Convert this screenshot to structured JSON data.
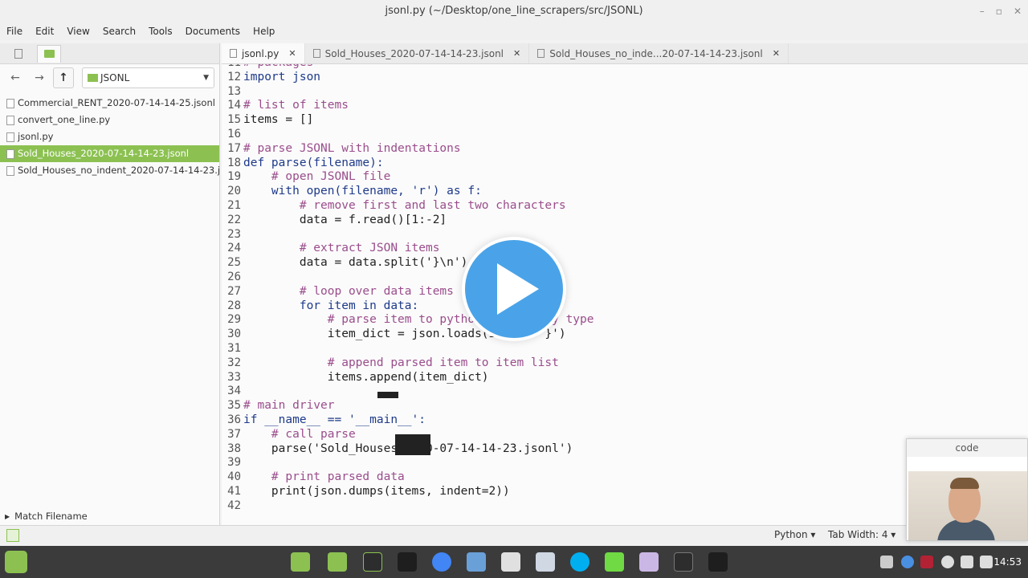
{
  "window": {
    "title": "jsonl.py (~/Desktop/one_line_scrapers/src/JSONL)"
  },
  "menu": [
    "File",
    "Edit",
    "View",
    "Search",
    "Tools",
    "Documents",
    "Help"
  ],
  "sidebar": {
    "path": "JSONL",
    "files": [
      "Commercial_RENT_2020-07-14-14-25.jsonl",
      "convert_one_line.py",
      "jsonl.py",
      "Sold_Houses_2020-07-14-14-23.jsonl",
      "Sold_Houses_no_indent_2020-07-14-14-23.jsonl"
    ],
    "selected_index": 3,
    "footer": "Match Filename"
  },
  "tabs": [
    "jsonl.py",
    "Sold_Houses_2020-07-14-14-23.jsonl",
    "Sold_Houses_no_inde...20-07-14-14-23.jsonl"
  ],
  "code": [
    {
      "n": "11",
      "text": "# packages",
      "cls": "c"
    },
    {
      "n": "12",
      "text": "import json",
      "cls": "k"
    },
    {
      "n": "13",
      "text": "",
      "cls": "t"
    },
    {
      "n": "14",
      "text": "# list of items",
      "cls": "c"
    },
    {
      "n": "15",
      "text": "items = []",
      "cls": "t"
    },
    {
      "n": "16",
      "text": "",
      "cls": "t"
    },
    {
      "n": "17",
      "text": "# parse JSONL with indentations",
      "cls": "c"
    },
    {
      "n": "18",
      "text": "def parse(filename):",
      "cls": "k"
    },
    {
      "n": "19",
      "text": "    # open JSONL file",
      "cls": "c"
    },
    {
      "n": "20",
      "text": "    with open(filename, 'r') as f:",
      "cls": "k"
    },
    {
      "n": "21",
      "text": "        # remove first and last two characters",
      "cls": "c"
    },
    {
      "n": "22",
      "text": "        data = f.read()[1:-2]",
      "cls": "t"
    },
    {
      "n": "23",
      "text": "",
      "cls": "t"
    },
    {
      "n": "24",
      "text": "        # extract JSON items",
      "cls": "c"
    },
    {
      "n": "25",
      "text": "        data = data.split('}\\n')",
      "cls": "t"
    },
    {
      "n": "26",
      "text": "",
      "cls": "t"
    },
    {
      "n": "27",
      "text": "        # loop over data items",
      "cls": "c"
    },
    {
      "n": "28",
      "text": "        for item in data:",
      "cls": "k"
    },
    {
      "n": "29",
      "text": "            # parse item to python dictionary type",
      "cls": "c"
    },
    {
      "n": "30",
      "text": "            item_dict = json.loads(item + '}')",
      "cls": "t"
    },
    {
      "n": "31",
      "text": "",
      "cls": "t"
    },
    {
      "n": "32",
      "text": "            # append parsed item to item list",
      "cls": "c"
    },
    {
      "n": "33",
      "text": "            items.append(item_dict)",
      "cls": "t"
    },
    {
      "n": "34",
      "text": "",
      "cls": "t"
    },
    {
      "n": "35",
      "text": "# main driver",
      "cls": "c"
    },
    {
      "n": "36",
      "text": "if __name__ == '__main__':",
      "cls": "k"
    },
    {
      "n": "37",
      "text": "    # call parse",
      "cls": "c"
    },
    {
      "n": "38",
      "text": "    parse('Sold_Houses_2020-07-14-14-23.jsonl')",
      "cls": "t"
    },
    {
      "n": "39",
      "text": "",
      "cls": "t"
    },
    {
      "n": "40",
      "text": "    # print parsed data",
      "cls": "c"
    },
    {
      "n": "41",
      "text": "    print(json.dumps(items, indent=2))",
      "cls": "t"
    },
    {
      "n": "42",
      "text": "",
      "cls": "t"
    }
  ],
  "status": {
    "language": "Python ▾",
    "tab_width": "Tab Width: 4 ▾"
  },
  "camera": {
    "title": "code"
  },
  "taskbar": {
    "clock": "14:53"
  },
  "colors": {
    "accent": "#8cc152",
    "play": "#4aa3e8"
  }
}
